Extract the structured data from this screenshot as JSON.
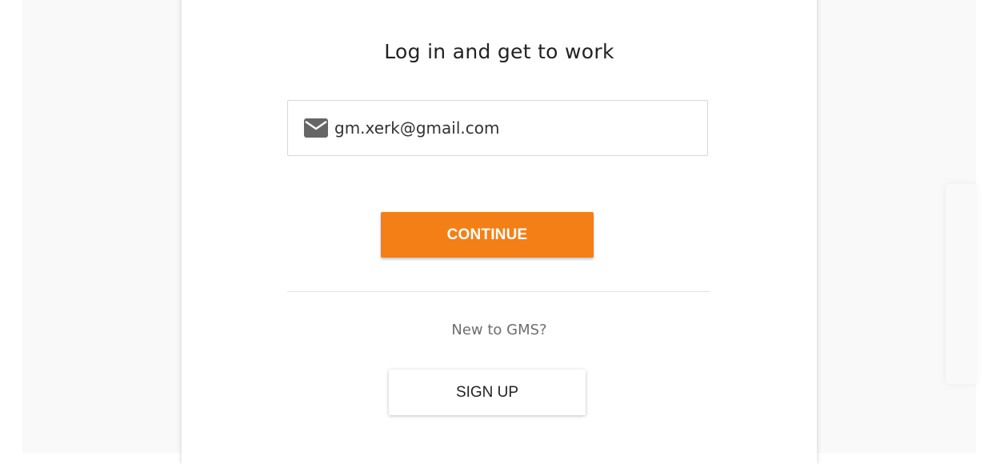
{
  "login": {
    "title": "Log in and get to work",
    "email_value": "gm.xerk@gmail.com",
    "email_icon": "mail-icon",
    "continue_label": "CONTINUE",
    "new_prompt": "New to GMS?",
    "signup_label": "SIGN UP"
  },
  "colors": {
    "accent": "#f47f17",
    "background": "#f9f9f9",
    "card": "#ffffff"
  }
}
